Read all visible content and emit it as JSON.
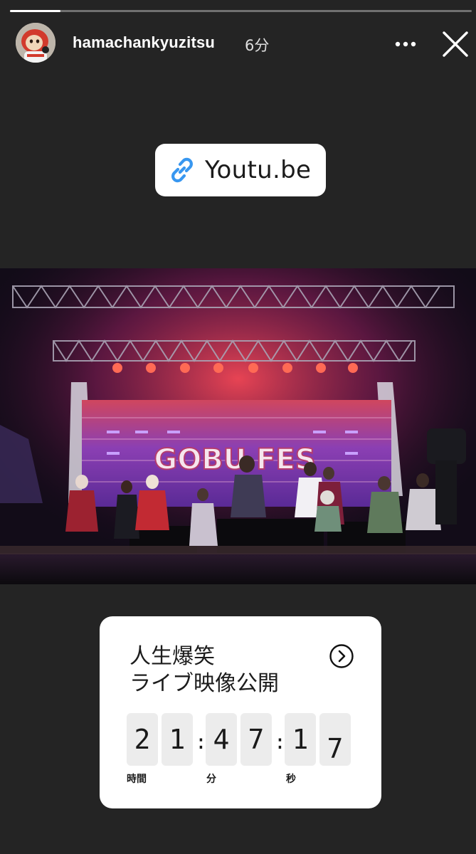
{
  "story": {
    "progress": 0.11
  },
  "header": {
    "username": "hamachankyuzitsu",
    "time": "6分",
    "more_icon": "more-horizontal-icon",
    "close_icon": "close-icon"
  },
  "link_sticker": {
    "icon": "link-icon",
    "label": "Youtu.be",
    "icon_color": "#3897f0"
  },
  "photo": {
    "stage_sign": "GOBU FES"
  },
  "countdown": {
    "title_line1": "人生爆笑",
    "title_line2": "ライブ映像公開",
    "arrow_icon": "chevron-right-circle-icon",
    "digits": [
      "2",
      "1",
      "4",
      "7",
      "1",
      "7"
    ],
    "separator": ":",
    "units": {
      "hours": "時間",
      "minutes": "分",
      "seconds": "秒"
    }
  },
  "colors": {
    "background": "#242424",
    "sticker": "#ffffff",
    "digit_bg": "#ececec"
  }
}
